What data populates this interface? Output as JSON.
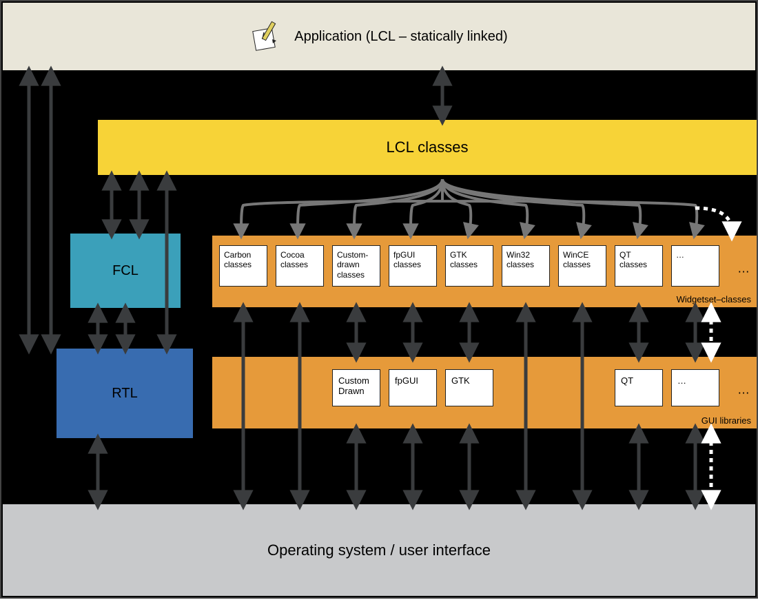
{
  "app": {
    "label": "Application (LCL – statically linked)"
  },
  "lcl": {
    "label": "LCL classes"
  },
  "fcl": {
    "label": "FCL"
  },
  "rtl": {
    "label": "RTL"
  },
  "os": {
    "label": "Operating system / user interface"
  },
  "widgetset": {
    "label": "Widgetset–classes",
    "boxes": [
      "Carbon classes",
      "Cocoa classes",
      "Custom-drawn classes",
      "fpGUI classes",
      "GTK classes",
      "Win32 classes",
      "WinCE classes",
      "QT classes",
      "…"
    ],
    "ellipsis": "…"
  },
  "gui": {
    "label": "GUI libraries",
    "boxes": {
      "custom": "Custom Drawn",
      "fpgui": "fpGUI",
      "gtk": "GTK",
      "qt": "QT",
      "more": "…"
    },
    "ellipsis": "…"
  }
}
